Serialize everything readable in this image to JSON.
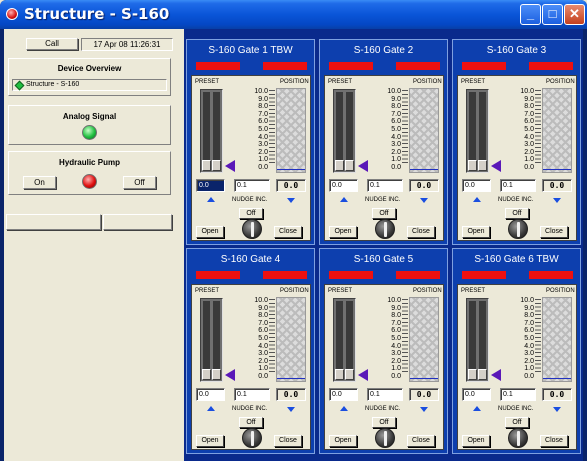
{
  "window": {
    "title": "Structure - S-160",
    "minimize_label": "_",
    "maximize_label": "□",
    "close_label": "✕"
  },
  "left": {
    "call_button": "Call",
    "timestamp": "17 Apr 08 11:26:31",
    "device_overview": {
      "title": "Device Overview",
      "item": "Structure - S-160"
    },
    "analog_signal": {
      "title": "Analog Signal"
    },
    "hydraulic_pump": {
      "title": "Hydraulic Pump",
      "on_button": "On",
      "off_button": "Off"
    }
  },
  "gate_labels": {
    "preset": "PRESET",
    "position": "POSITION",
    "nudge": "NUDGE INC.",
    "off": "Off",
    "open": "Open",
    "close": "Close",
    "scale": [
      "10.0",
      "9.0",
      "8.0",
      "7.0",
      "6.0",
      "5.0",
      "4.0",
      "3.0",
      "2.0",
      "1.0",
      "0.0"
    ]
  },
  "gates": [
    {
      "name": "S-160 Gate 1 TBW",
      "preset_value": "0.0",
      "nudge_value": "0.1",
      "position_readout": "0.0",
      "preset_fraction": 0.0,
      "position_fraction": 0.0
    },
    {
      "name": "S-160 Gate 2",
      "preset_value": "0.0",
      "nudge_value": "0.1",
      "position_readout": "0.0",
      "preset_fraction": 0.0,
      "position_fraction": 0.0
    },
    {
      "name": "S-160 Gate 3",
      "preset_value": "0.0",
      "nudge_value": "0.1",
      "position_readout": "0.0",
      "preset_fraction": 0.0,
      "position_fraction": 0.0
    },
    {
      "name": "S-160 Gate 4",
      "preset_value": "0.0",
      "nudge_value": "0.1",
      "position_readout": "0.0",
      "preset_fraction": 0.0,
      "position_fraction": 0.0
    },
    {
      "name": "S-160 Gate 5",
      "preset_value": "0.0",
      "nudge_value": "0.1",
      "position_readout": "0.0",
      "preset_fraction": 0.0,
      "position_fraction": 0.0
    },
    {
      "name": "S-160 Gate 6 TBW",
      "preset_value": "0.0",
      "nudge_value": "0.1",
      "position_readout": "0.0",
      "preset_fraction": 0.0,
      "position_fraction": 0.0
    }
  ],
  "colors": {
    "titlebar": "#0a55d8",
    "gate_panel": "#0d3fae",
    "status_bar": "#ee1010",
    "indicator_arrow": "#5a18b8",
    "analog_led": "#20c040",
    "pump_led": "#e01010"
  },
  "icons": {
    "app": "app-icon",
    "device_status": "green-diamond-icon",
    "nudge_up": "arrow-up-icon",
    "nudge_down": "arrow-down-icon",
    "gate_knob": "rotary-knob-icon"
  }
}
